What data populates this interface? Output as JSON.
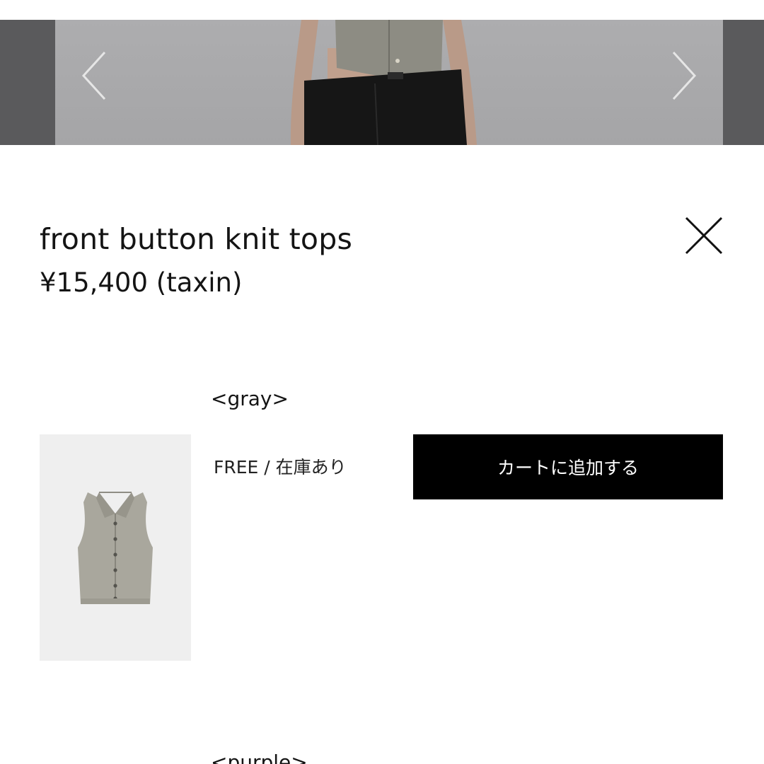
{
  "carousel": {
    "prev_icon": "chevron-left-icon",
    "next_icon": "chevron-right-icon"
  },
  "product": {
    "title": "front button knit tops",
    "price": "¥15,400 (taxin)",
    "close_icon": "close-icon"
  },
  "variants": [
    {
      "color_label": "<gray>",
      "stock_text": "FREE / 在庫あり",
      "add_to_cart_label": "カートに追加する"
    },
    {
      "color_label": "<purple>"
    }
  ],
  "colors": {
    "button_background": "#000000",
    "button_text": "#ffffff",
    "thumbnail_background": "#efefef",
    "garment_gray": "#a9a79d"
  }
}
